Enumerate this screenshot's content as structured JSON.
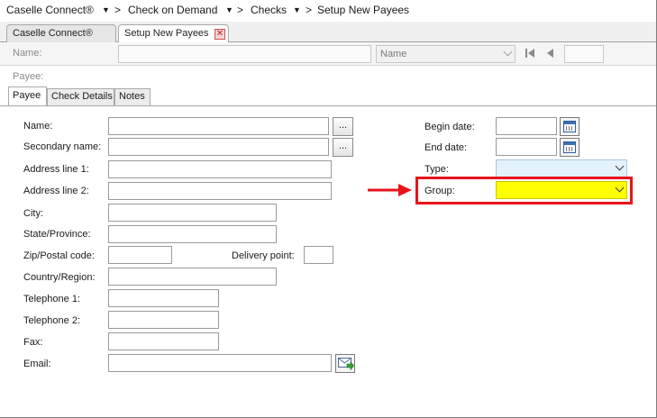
{
  "breadcrumb": {
    "items": [
      "Caselle Connect®",
      "Check on Demand",
      "Checks",
      "Setup New Payees"
    ]
  },
  "tabs": [
    {
      "label": "Caselle Connect®",
      "active": false
    },
    {
      "label": "Setup New Payees",
      "active": true
    }
  ],
  "name_bar": {
    "name_label": "Name:",
    "name_value": "",
    "sort_label": "Name",
    "nav_value": ""
  },
  "payee_label": "Payee:",
  "sub_tabs": [
    {
      "label": "Payee",
      "active": true
    },
    {
      "label": "Check Details",
      "active": false
    },
    {
      "label": "Notes",
      "active": false
    }
  ],
  "form": {
    "name_label": "Name:",
    "secondary_name_label": "Secondary name:",
    "address1_label": "Address line 1:",
    "address2_label": "Address line 2:",
    "city_label": "City:",
    "state_label": "State/Province:",
    "zip_label": "Zip/Postal code:",
    "delivery_point_label": "Delivery point:",
    "country_label": "Country/Region:",
    "telephone1_label": "Telephone 1:",
    "telephone2_label": "Telephone 2:",
    "fax_label": "Fax:",
    "email_label": "Email:",
    "begin_date_label": "Begin date:",
    "end_date_label": "End date:",
    "type_label": "Type:",
    "group_label": "Group:",
    "ellipsis": "..."
  },
  "colors": {
    "highlight_red": "#e8141c",
    "group_field_yellow": "#ffff00",
    "type_field_blue": "#e3f2fc"
  }
}
